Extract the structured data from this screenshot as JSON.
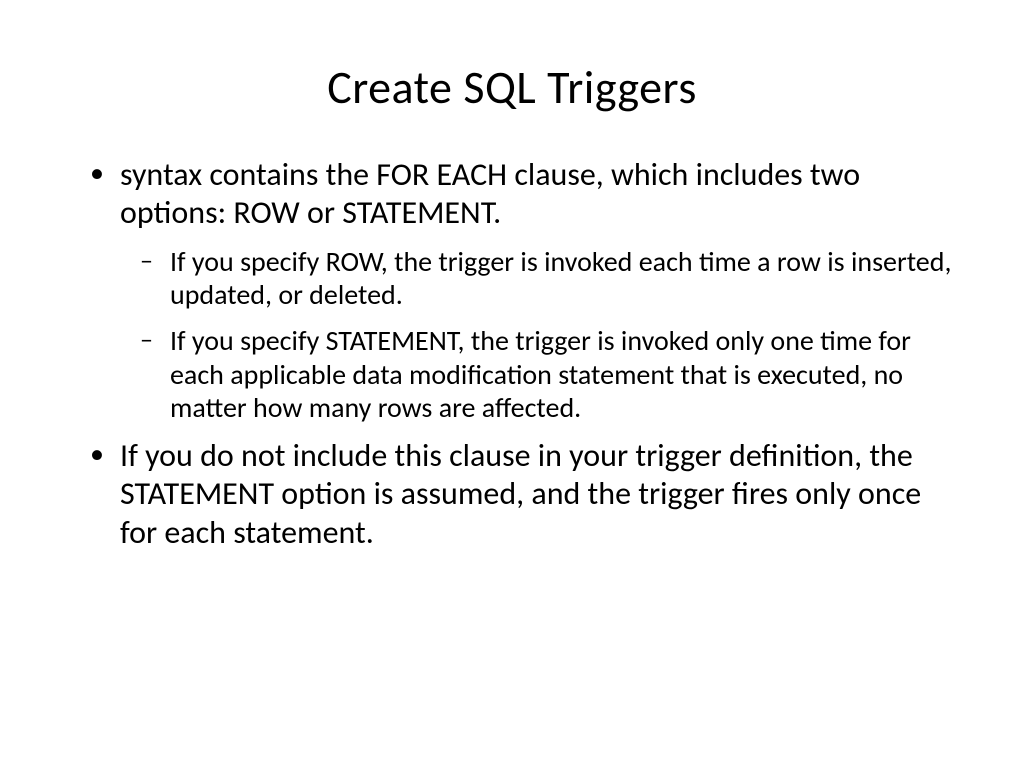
{
  "title": "Create SQL Triggers",
  "bullets": {
    "item1": "syntax contains the FOR EACH clause, which includes two options: ROW or STATEMENT.",
    "sub1": "If you specify ROW, the trigger is invoked each time a row is inserted, updated, or deleted.",
    "sub2": " If you specify STATEMENT, the trigger is invoked only one time for each applicable data modification statement that is executed, no matter how many rows are affected.",
    "item2": "If you do not include this clause in your trigger definition, the STATEMENT option is assumed, and the trigger fires only once for each statement."
  }
}
